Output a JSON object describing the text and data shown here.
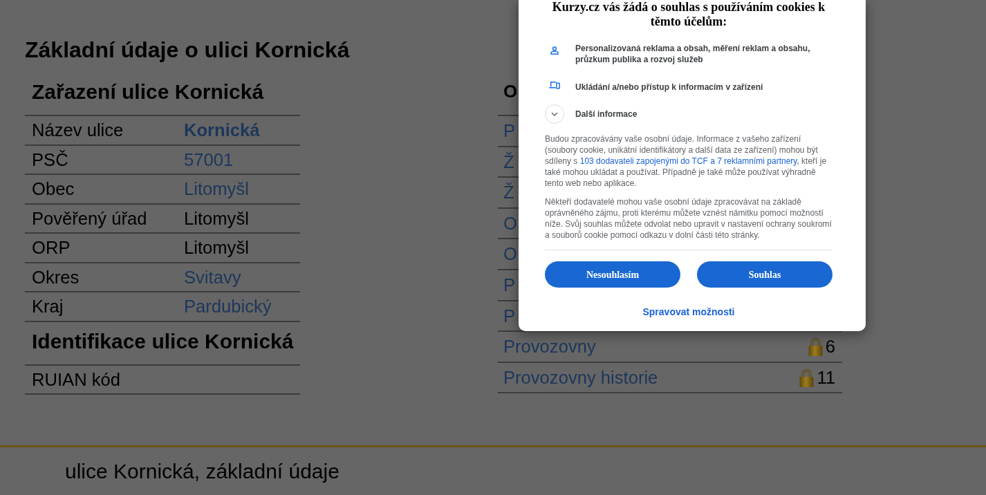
{
  "page": {
    "title": "Základní údaje o ulici Kornická"
  },
  "left_sections": [
    {
      "heading": "Zařazení ulice Kornická",
      "rows": [
        {
          "label": "Název ulice",
          "value": "Kornická",
          "kind": "current"
        },
        {
          "label": "PSČ",
          "value": "57001",
          "kind": "link"
        },
        {
          "label": "Obec",
          "value": "Litomyšl",
          "kind": "link"
        },
        {
          "label": "Pověřený úřad",
          "value": "Litomyšl",
          "kind": "text"
        },
        {
          "label": "ORP",
          "value": "Litomyšl",
          "kind": "text"
        },
        {
          "label": "Okres",
          "value": "Svitavy",
          "kind": "link"
        },
        {
          "label": "Kraj",
          "value": "Pardubický",
          "kind": "link"
        }
      ]
    },
    {
      "heading": "Identifikace ulice Kornická",
      "rows": [
        {
          "label": "RUIAN kód"
        }
      ]
    }
  ],
  "right_section": {
    "heading": "O",
    "rows": [
      {
        "label": "P"
      },
      {
        "label": "Ž"
      },
      {
        "label": "Ž"
      },
      {
        "label": "O"
      },
      {
        "label": "O"
      },
      {
        "label": "P"
      },
      {
        "label": "P"
      },
      {
        "label": "Provozovny",
        "locked": true,
        "count": "6"
      },
      {
        "label": "Provozovny historie",
        "locked": true,
        "count": "11"
      }
    ]
  },
  "footer": {
    "text": "ulice Kornická, základní údaje"
  },
  "consent_dialog": {
    "title": "Kurzy.cz vás žádá o souhlas s používáním cookies k těmto účelům:",
    "purposes": [
      {
        "kind": "person",
        "text": "Personalizovaná reklama a obsah, měření reklam a obsahu, průzkum publika a rozvoj služeb"
      },
      {
        "kind": "device",
        "text": "Ukládání a/nebo přístup k informacím v zařízení"
      }
    ],
    "more_info": {
      "label": "Další informace",
      "expanded": false
    },
    "paragraphs": [
      [
        {
          "kind": "text",
          "text": "Budou zpracovávány vaše osobní údaje. Informace z vašeho zařízení (soubory cookie, unikátní identifikátory a další data ze zařízení) mohou být sdíleny s "
        },
        {
          "kind": "link",
          "text": "103 dodavateli zapojenými do TCF a 7 reklamními partnery"
        },
        {
          "kind": "text",
          "text": ", kteří je také mohou ukládat a používat. Případně je také může používat výhradně tento web nebo aplikace."
        }
      ],
      [
        {
          "kind": "text",
          "text": "Někteří dodavatelé mohou vaše osobní údaje zpracovávat na základě oprávněného zájmu, proti kterému můžete vznést námitku pomocí možností níže. Svůj souhlas můžete odvolat nebo upravit v nastavení ochrany soukromí a souborů cookie pomocí odkazu v dolní části této stránky."
        }
      ]
    ],
    "buttons": [
      "Nesouhlasím",
      "Souhlas"
    ],
    "manage_link": "Spravovat možnosti"
  }
}
